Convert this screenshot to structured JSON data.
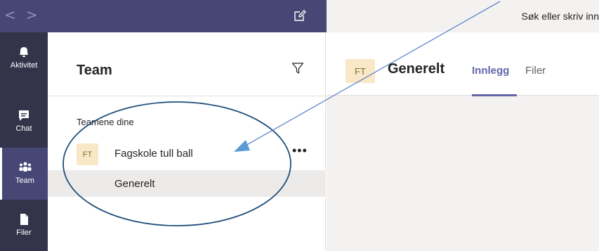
{
  "titlebar": {
    "back": "<",
    "forward": ">",
    "search_placeholder": "Søk eller skriv inn"
  },
  "rail": {
    "items": [
      {
        "label": "Aktivitet",
        "icon": "bell-icon"
      },
      {
        "label": "Chat",
        "icon": "chat-icon"
      },
      {
        "label": "Team",
        "icon": "team-icon",
        "active": true
      },
      {
        "label": "Filer",
        "icon": "file-icon"
      }
    ]
  },
  "panel": {
    "title": "Team",
    "section_label": "Teamene dine",
    "team": {
      "avatar": "FT",
      "name": "Fagskole tull ball",
      "more": "•••"
    },
    "channel": {
      "name": "Generelt"
    }
  },
  "main": {
    "avatar": "FT",
    "channel_title": "Generelt",
    "tabs": [
      {
        "label": "Innlegg",
        "selected": true
      },
      {
        "label": "Filer",
        "selected": false
      }
    ]
  },
  "colors": {
    "titlebar": "#464775",
    "rail": "#33344a",
    "accent": "#6264a7",
    "annotation": "#1f4e79",
    "annotation_line": "#4472c4"
  }
}
